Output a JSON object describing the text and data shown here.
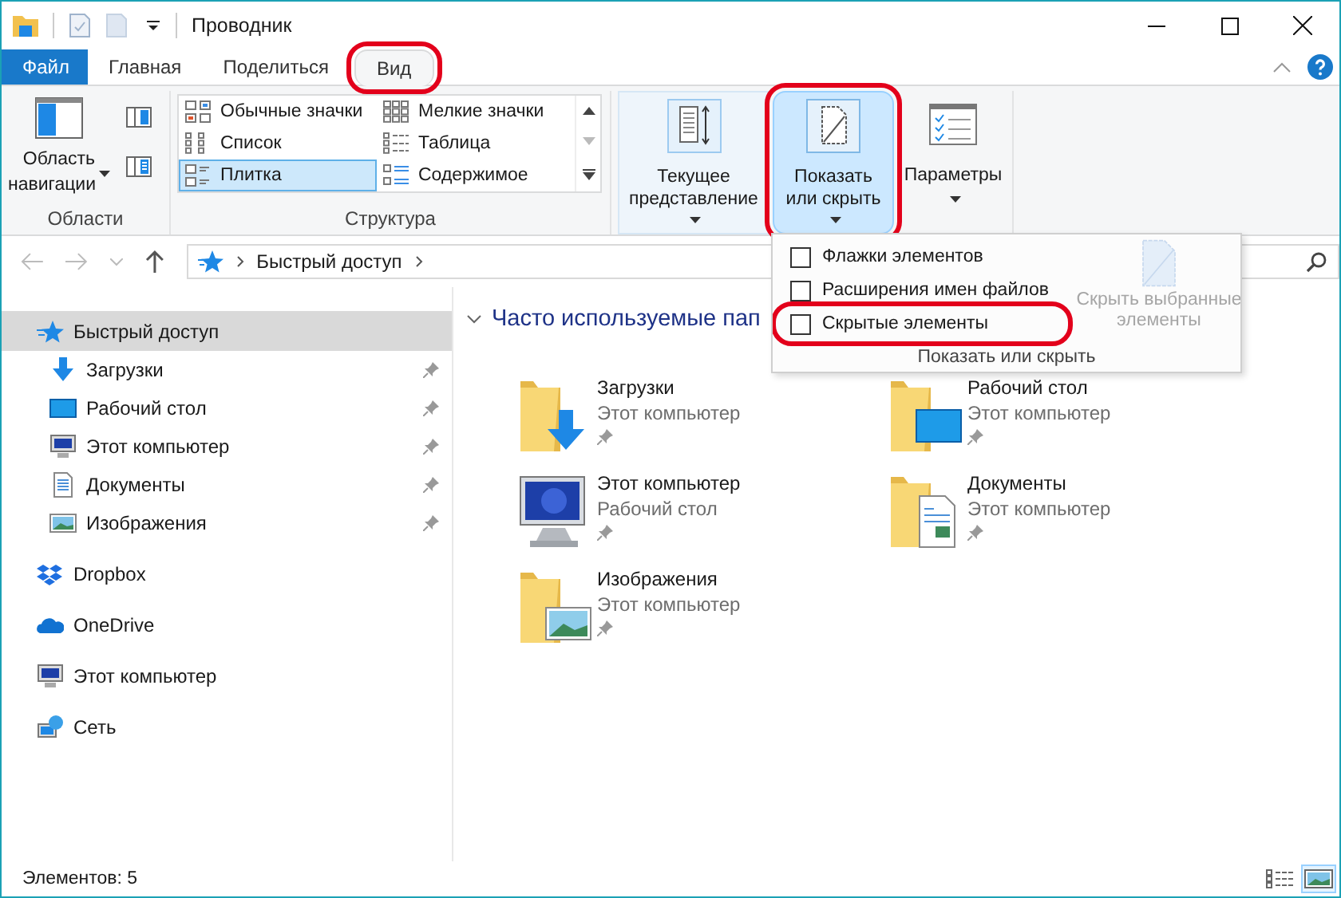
{
  "window": {
    "title": "Проводник"
  },
  "tabs": [
    {
      "label": "Файл",
      "kind": "file",
      "selected": false,
      "highlighted": false
    },
    {
      "label": "Главная",
      "kind": "tab",
      "selected": false,
      "highlighted": false
    },
    {
      "label": "Поделиться",
      "kind": "tab",
      "selected": false,
      "highlighted": false
    },
    {
      "label": "Вид",
      "kind": "tab",
      "selected": true,
      "highlighted": true
    }
  ],
  "ribbon": {
    "panes": {
      "label": "Области",
      "button": {
        "label": "Область навигации",
        "dropdown": true
      }
    },
    "layout": {
      "label": "Структура",
      "options": [
        {
          "label": "Обычные значки",
          "kind": "medium",
          "selected": false
        },
        {
          "label": "Мелкие значки",
          "kind": "small",
          "selected": false
        },
        {
          "label": "Список",
          "kind": "list",
          "selected": false
        },
        {
          "label": "Таблица",
          "kind": "details",
          "selected": false
        },
        {
          "label": "Плитка",
          "kind": "tiles",
          "selected": true
        },
        {
          "label": "Содержимое",
          "kind": "content",
          "selected": false
        }
      ]
    },
    "buttons": [
      {
        "label": "Текущее представление",
        "kind": "current-view",
        "selected": false,
        "dropdown": true,
        "highlighted": false
      },
      {
        "label": "Показать или скрыть",
        "kind": "show-hide",
        "selected": true,
        "dropdown": true,
        "highlighted": true
      },
      {
        "label": "Параметры",
        "kind": "options",
        "selected": false,
        "dropdown": true,
        "highlighted": false
      }
    ]
  },
  "address_bar": {
    "path": [
      "Быстрый доступ"
    ]
  },
  "sidebar": {
    "items": [
      {
        "label": "Быстрый доступ",
        "kind": "quick-access",
        "selected": true,
        "pinned": false,
        "children": [
          {
            "label": "Загрузки",
            "kind": "downloads",
            "selected": false,
            "pinned": true
          },
          {
            "label": "Рабочий стол",
            "kind": "desktop",
            "selected": false,
            "pinned": true
          },
          {
            "label": "Этот компьютер",
            "kind": "computer",
            "selected": false,
            "pinned": true
          },
          {
            "label": "Документы",
            "kind": "documents",
            "selected": false,
            "pinned": true
          },
          {
            "label": "Изображения",
            "kind": "pictures",
            "selected": false,
            "pinned": true
          }
        ]
      },
      {
        "label": "Dropbox",
        "kind": "dropbox",
        "selected": false,
        "pinned": false
      },
      {
        "label": "OneDrive",
        "kind": "onedrive",
        "selected": false,
        "pinned": false
      },
      {
        "label": "Этот компьютер",
        "kind": "computer",
        "selected": false,
        "pinned": false
      },
      {
        "label": "Сеть",
        "kind": "network",
        "selected": false,
        "pinned": false
      }
    ]
  },
  "content": {
    "group": {
      "title": "Часто используемые пап",
      "expanded": true
    },
    "tiles": [
      {
        "name": "Загрузки",
        "location": "Этот компьютер",
        "kind": "downloads",
        "pinned": true
      },
      {
        "name": "Рабочий стол",
        "location": "Этот компьютер",
        "kind": "desktop",
        "pinned": true
      },
      {
        "name": "Этот компьютер",
        "location": "Рабочий стол",
        "kind": "computer",
        "pinned": true
      },
      {
        "name": "Документы",
        "location": "Этот компьютер",
        "kind": "documents",
        "pinned": true
      },
      {
        "name": "Изображения",
        "location": "Этот компьютер",
        "kind": "pictures",
        "pinned": true
      }
    ]
  },
  "menu": {
    "options": [
      {
        "label": "Флажки элементов",
        "checked": false,
        "highlighted": false
      },
      {
        "label": "Расширения имен файлов",
        "checked": false,
        "highlighted": false
      },
      {
        "label": "Скрытые элементы",
        "checked": false,
        "highlighted": true
      }
    ],
    "action": {
      "label": "Скрыть выбранные элементы",
      "disabled": true
    },
    "footer": "Показать или скрыть"
  },
  "status_bar": {
    "count": "Элементов: 5",
    "views": [
      {
        "kind": "details",
        "selected": false
      },
      {
        "kind": "tiles",
        "selected": true
      }
    ]
  }
}
